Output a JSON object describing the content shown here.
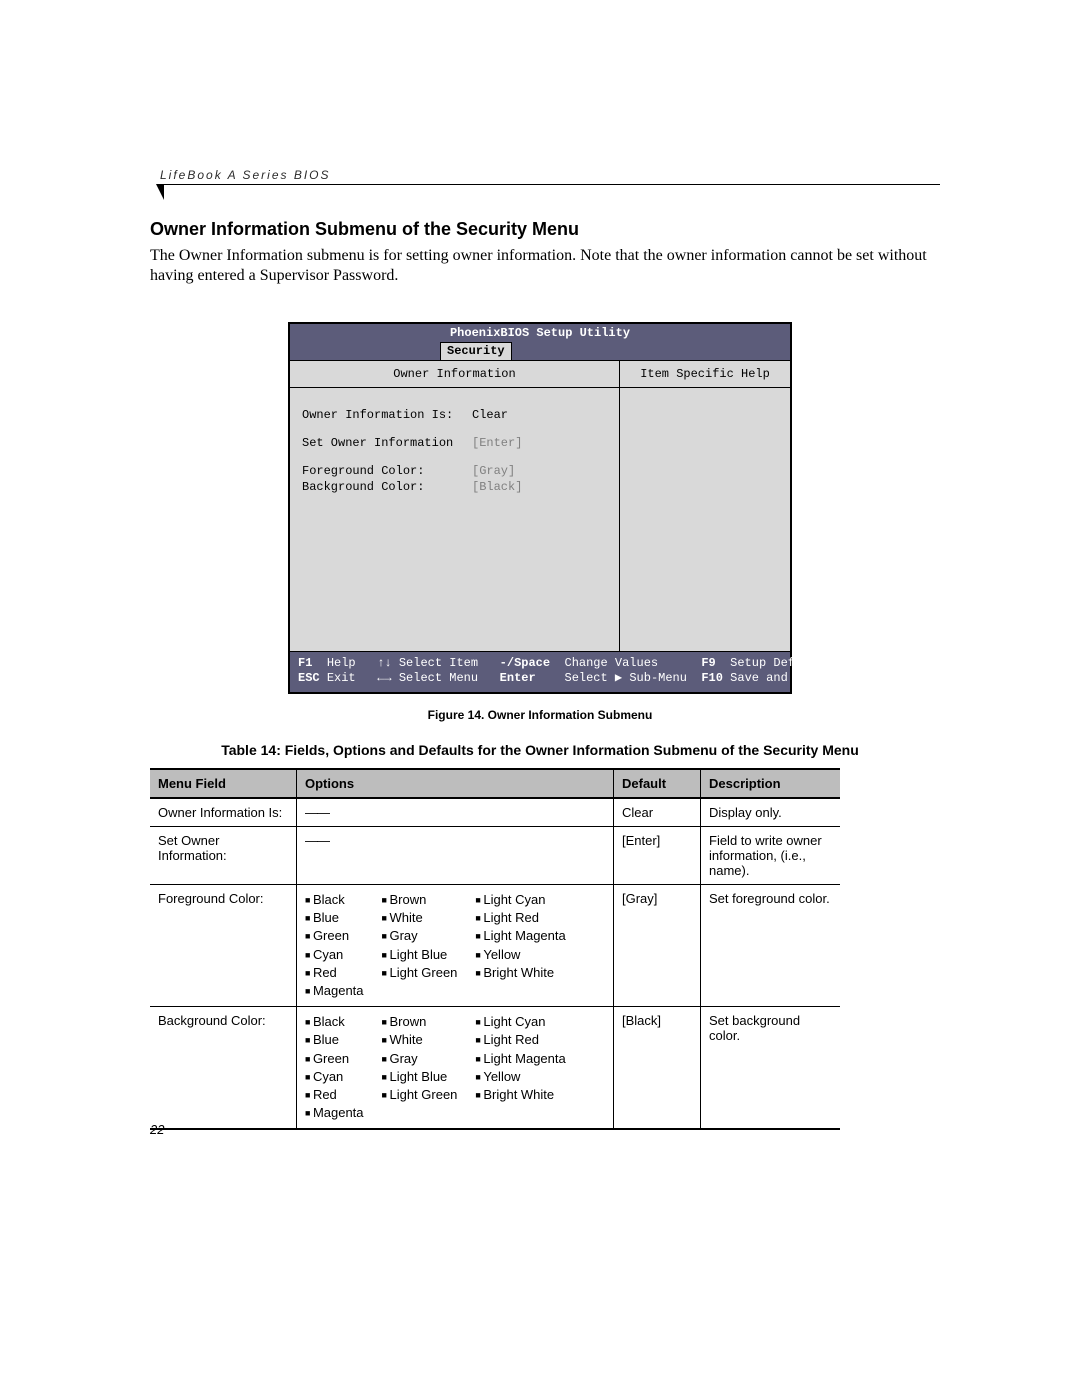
{
  "runningHead": "LifeBook A Series BIOS",
  "sectionTitle": "Owner Information Submenu of the Security Menu",
  "bodyText": "The Owner Information submenu is for setting owner information. Note that the owner information cannot be set without having entered a Supervisor Password.",
  "bios": {
    "title": "PhoenixBIOS Setup Utility",
    "activeTab": "Security",
    "leftTitle": "Owner Information",
    "rightTitle": "Item Specific Help",
    "rows": [
      {
        "label": "Owner Information Is:",
        "value": "Clear",
        "dim": false
      },
      {
        "label": "Set Owner Information",
        "value": "[Enter]",
        "dim": true
      },
      {
        "label": "Foreground Color:",
        "value": "[Gray]",
        "dim": true
      },
      {
        "label": "Background Color:",
        "value": "[Black]",
        "dim": true
      }
    ],
    "footer": {
      "line1": {
        "f1": "F1",
        "help": "Help",
        "arrows1": "↑↓",
        "selectItem": "Select Item",
        "minusSpace": "-/Space",
        "changeValues": "Change Values",
        "f9": "F9",
        "setupDefaults": "Setup Defaults"
      },
      "line2": {
        "esc": "ESC",
        "exit": "Exit",
        "arrows2": "←→",
        "selectMenu": "Select Menu",
        "enter": "Enter",
        "selectSub": "Select ▶ Sub-Menu",
        "f10": "F10",
        "saveExit": "Save and Exit"
      }
    }
  },
  "figureCaption": "Figure 14.   Owner Information Submenu",
  "tableTitle": "Table 14: Fields, Options and Defaults for the Owner Information Submenu of the Security Menu",
  "table": {
    "headers": {
      "menu": "Menu Field",
      "options": "Options",
      "def": "Default",
      "desc": "Description"
    },
    "colorOptions": {
      "col1": [
        "Black",
        "Blue",
        "Green",
        "Cyan",
        "Red",
        "Magenta"
      ],
      "col2": [
        "Brown",
        "White",
        "Gray",
        "Light Blue",
        "Light Green"
      ],
      "col3": [
        "Light Cyan",
        "Light Red",
        "Light Magenta",
        "Yellow",
        "Bright White"
      ]
    },
    "rows": [
      {
        "menu": "Owner Information Is:",
        "optionsDash": "——",
        "def": "Clear",
        "desc": "Display only."
      },
      {
        "menu": "Set Owner Information:",
        "optionsDash": "——",
        "def": "[Enter]",
        "desc": "Field to write owner infor­mation, (i.e., name)."
      },
      {
        "menu": "Foreground Color:",
        "useColors": true,
        "def": "[Gray]",
        "desc": "Set foreground color."
      },
      {
        "menu": "Background Color:",
        "useColors": true,
        "def": "[Black]",
        "desc": "Set background color."
      }
    ]
  },
  "pageNumber": "22"
}
